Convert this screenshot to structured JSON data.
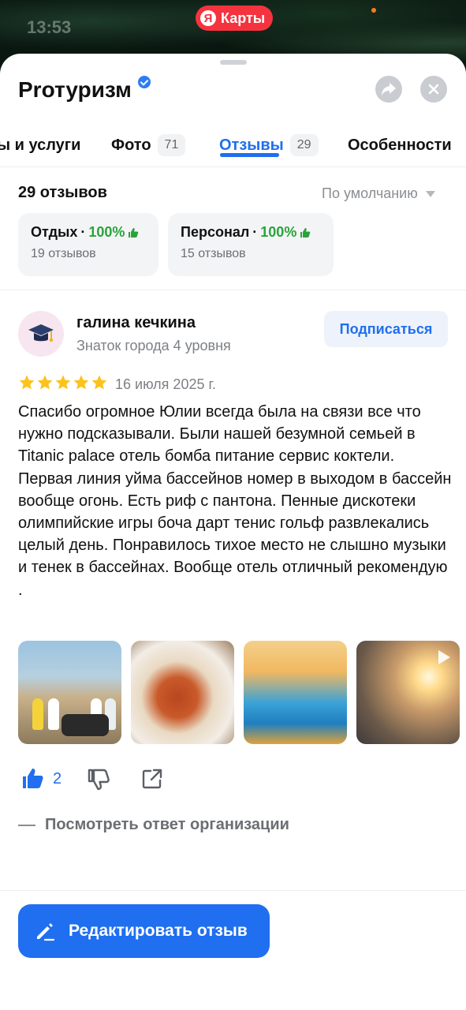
{
  "status": {
    "time": "13:53"
  },
  "app_badge": {
    "logo_letter": "Я",
    "label": "Карты"
  },
  "org": {
    "name": "Prотуризм"
  },
  "tabs": [
    {
      "label": "ы и услуги",
      "count": ""
    },
    {
      "label": "Фото",
      "count": "71"
    },
    {
      "label": "Отзывы",
      "count": "29"
    },
    {
      "label": "Особенности",
      "count": ""
    }
  ],
  "reviews": {
    "count_label": "29 отзывов",
    "sort_label": "По умолчанию",
    "aspects": [
      {
        "name": "Отдых",
        "sep": "·",
        "percent": "100%",
        "sub": "19 отзывов"
      },
      {
        "name": "Персонал",
        "sep": "·",
        "percent": "100%",
        "sub": "15 отзывов"
      }
    ]
  },
  "review": {
    "author": "галина кечкина",
    "level": "Знаток города 4 уровня",
    "subscribe_label": "Подписаться",
    "rating": 5,
    "date": "16 июля 2025 г.",
    "text": "Спасибо огромное Юлии всегда была на связи все что нужно подсказывали. Были нашей безумной семьей в Titanic palace отель бомба питание сервис коктели. Первая линия уйма бассейнов номер в выходом в бассейн вообще огонь. Есть риф с пантона. Пенные дискотеки олимпийские игры боча дарт тенис гольф развлекались целый день. Понравилось тихое место не слышно музыки и тенек в бассейнах. Вообще отель отличный рекомендую .",
    "likes": "2",
    "org_reply_label": "Посмотреть ответ организации"
  },
  "edit_button": {
    "label": "Редактировать отзыв"
  },
  "colors": {
    "accent": "#1f6ff0",
    "positive": "#2aa33a",
    "star": "#fcc31e",
    "brand_red": "#f5333f"
  },
  "icons": [
    "verified-icon",
    "share-icon",
    "close-icon",
    "thumb-up-icon",
    "thumb-down-icon",
    "external-share-icon",
    "pencil-icon",
    "play-icon",
    "graduation-cap-icon",
    "star-icon"
  ]
}
